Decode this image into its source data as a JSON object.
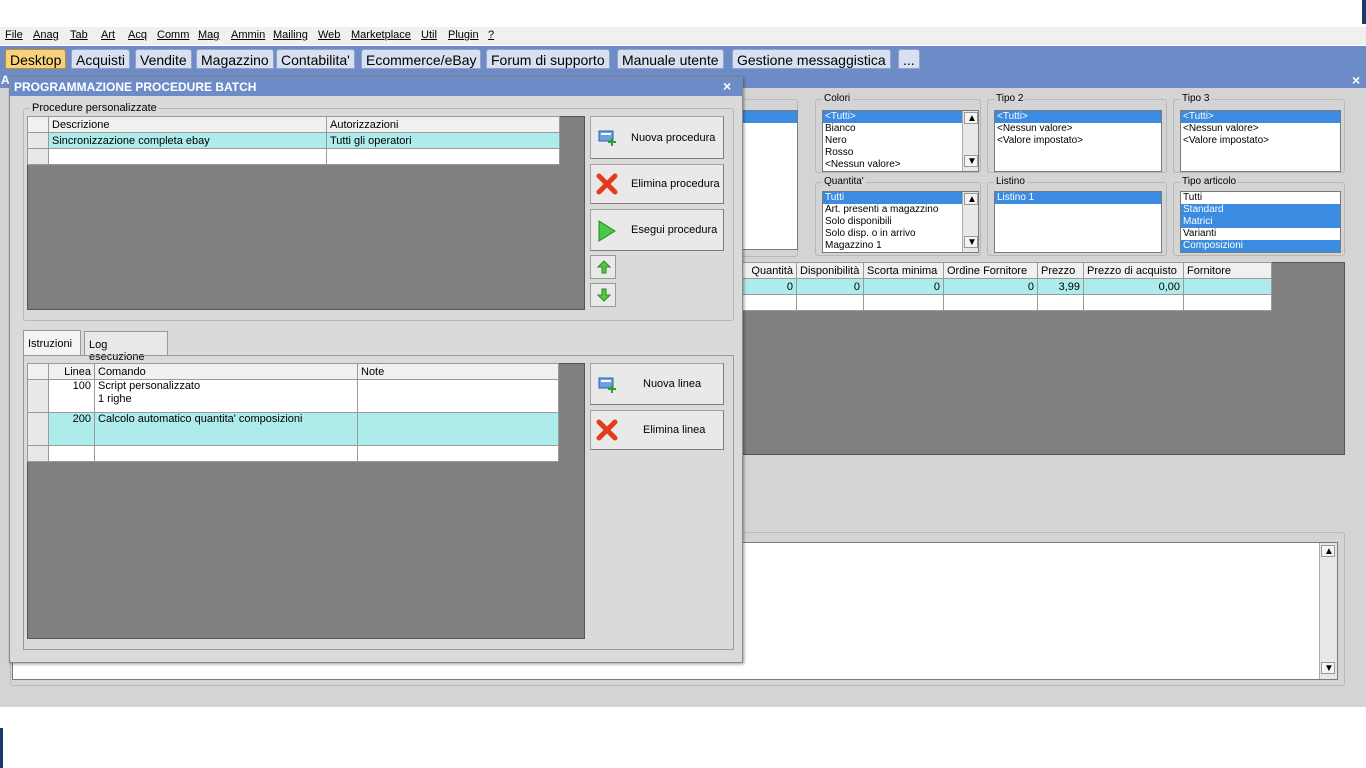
{
  "menu": [
    "File",
    "Anag",
    "Tab",
    "Art",
    "Acq",
    "Comm",
    "Mag",
    "Ammin",
    "Mailing",
    "Web",
    "Marketplace",
    "Util",
    "Plugin",
    "?"
  ],
  "tabs": [
    "Desktop",
    "Acquisti",
    "Vendite",
    "Magazzino",
    "Contabilita'",
    "Ecommerce/eBay",
    "Forum di supporto",
    "Manuale utente",
    "Gestione messaggistica",
    "..."
  ],
  "background": {
    "title_letter": "A",
    "close": "×",
    "filters": {
      "colori": {
        "label": "Colori",
        "items": [
          "<Tutti>",
          "Bianco",
          "Nero",
          "Rosso",
          "<Nessun valore>"
        ]
      },
      "tipo2": {
        "label": "Tipo 2",
        "items": [
          "<Tutti>",
          "<Nessun valore>",
          "<Valore impostato>"
        ]
      },
      "tipo3": {
        "label": "Tipo 3",
        "items": [
          "<Tutti>",
          "<Nessun valore>",
          "<Valore impostato>"
        ]
      },
      "quantita": {
        "label": "Quantita'",
        "items": [
          "Tutti",
          "Art. presenti a magazzino",
          "Solo disponibili",
          "Solo disp. o in arrivo",
          "Magazzino 1"
        ]
      },
      "listino": {
        "label": "Listino",
        "items": [
          "Listino 1"
        ]
      },
      "tipo_articolo": {
        "label": "Tipo articolo",
        "items": [
          "Tutti",
          "Standard",
          "Matrici",
          "Varianti",
          "Composizioni"
        ]
      }
    },
    "table": {
      "headers": [
        "Quantità",
        "Disponibilità",
        "Scorta minima",
        "Ordine Fornitore",
        "Prezzo",
        "Prezzo di acquisto",
        "Fornitore"
      ],
      "row": [
        "0",
        "0",
        "0",
        "0",
        "3,99",
        "0,00",
        ""
      ]
    }
  },
  "dialog": {
    "title": "PROGRAMMAZIONE PROCEDURE BATCH",
    "close": "×",
    "procedures_group": "Procedure personalizzate",
    "procedures_headers": [
      "Descrizione",
      "Autorizzazioni"
    ],
    "procedures_rows": [
      [
        "Sincronizzazione completa ebay",
        "Tutti gli operatori"
      ]
    ],
    "buttons": {
      "new": "Nuova procedura",
      "delete": "Elimina procedura",
      "run": "Esegui procedura",
      "new_line": "Nuova linea",
      "delete_line": "Elimina linea"
    },
    "tabs": [
      "Istruzioni",
      "Log esecuzione"
    ],
    "lines_headers": [
      "Linea",
      "Comando",
      "Note"
    ],
    "lines_rows": [
      {
        "linea": "100",
        "comando": "Script personalizzato",
        "comando2": "1 righe",
        "note": ""
      },
      {
        "linea": "200",
        "comando": "Calcolo automatico quantita' composizioni",
        "comando2": "",
        "note": ""
      }
    ]
  },
  "colors": {
    "titlebar": "#6d8cc7",
    "selection": "#3b8be0",
    "highlight_row": "#aeebeb",
    "active_tab": "#f6d27a"
  }
}
